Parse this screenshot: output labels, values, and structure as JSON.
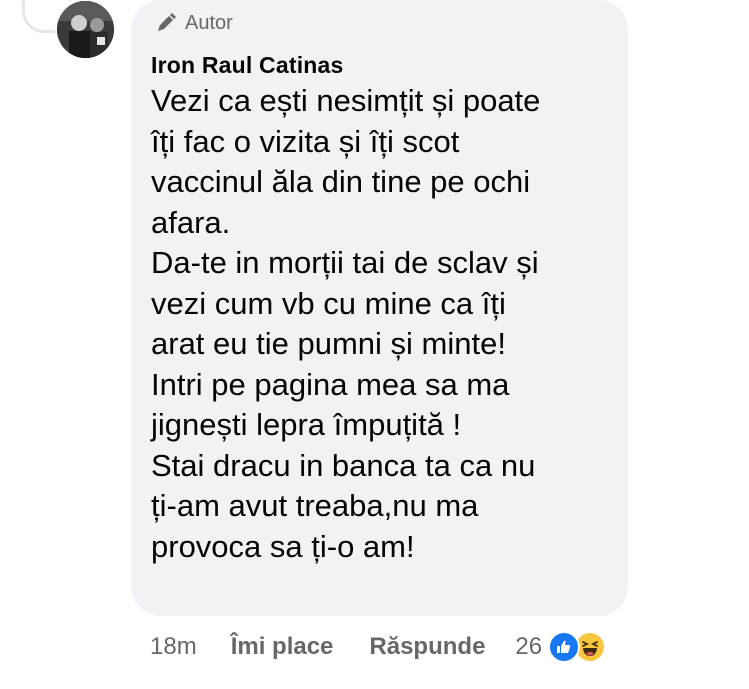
{
  "comment": {
    "badge_label": "Autor",
    "author_name": "Iron Raul Catinas",
    "text": "Vezi ca ești nesimțit și poate\nîți fac o vizita și îți scot\nvaccinul ăla din tine pe ochi\nafara.\nDa-te in morții tai de sclav și\nvezi cum vb cu mine ca îți\narat eu tie pumni și minte!\nIntri pe pagina mea sa ma\njignești lepra împuțită !\nStai dracu in banca ta ca nu\nți-am avut treaba,nu ma\nprovoca sa ți-o am!"
  },
  "actions": {
    "time": "18m",
    "like_label": "Îmi place",
    "reply_label": "Răspunde",
    "reaction_count": "26"
  },
  "icons": {
    "badge_icon": "pen-icon",
    "reactions": [
      "like-reaction-icon",
      "haha-reaction-icon"
    ]
  },
  "colors": {
    "bubble_bg": "#f0f2f5",
    "secondary_text": "#65676b",
    "primary_text": "#050505",
    "like_blue": "#1877f2",
    "haha_yellow": "#f7c63e"
  }
}
